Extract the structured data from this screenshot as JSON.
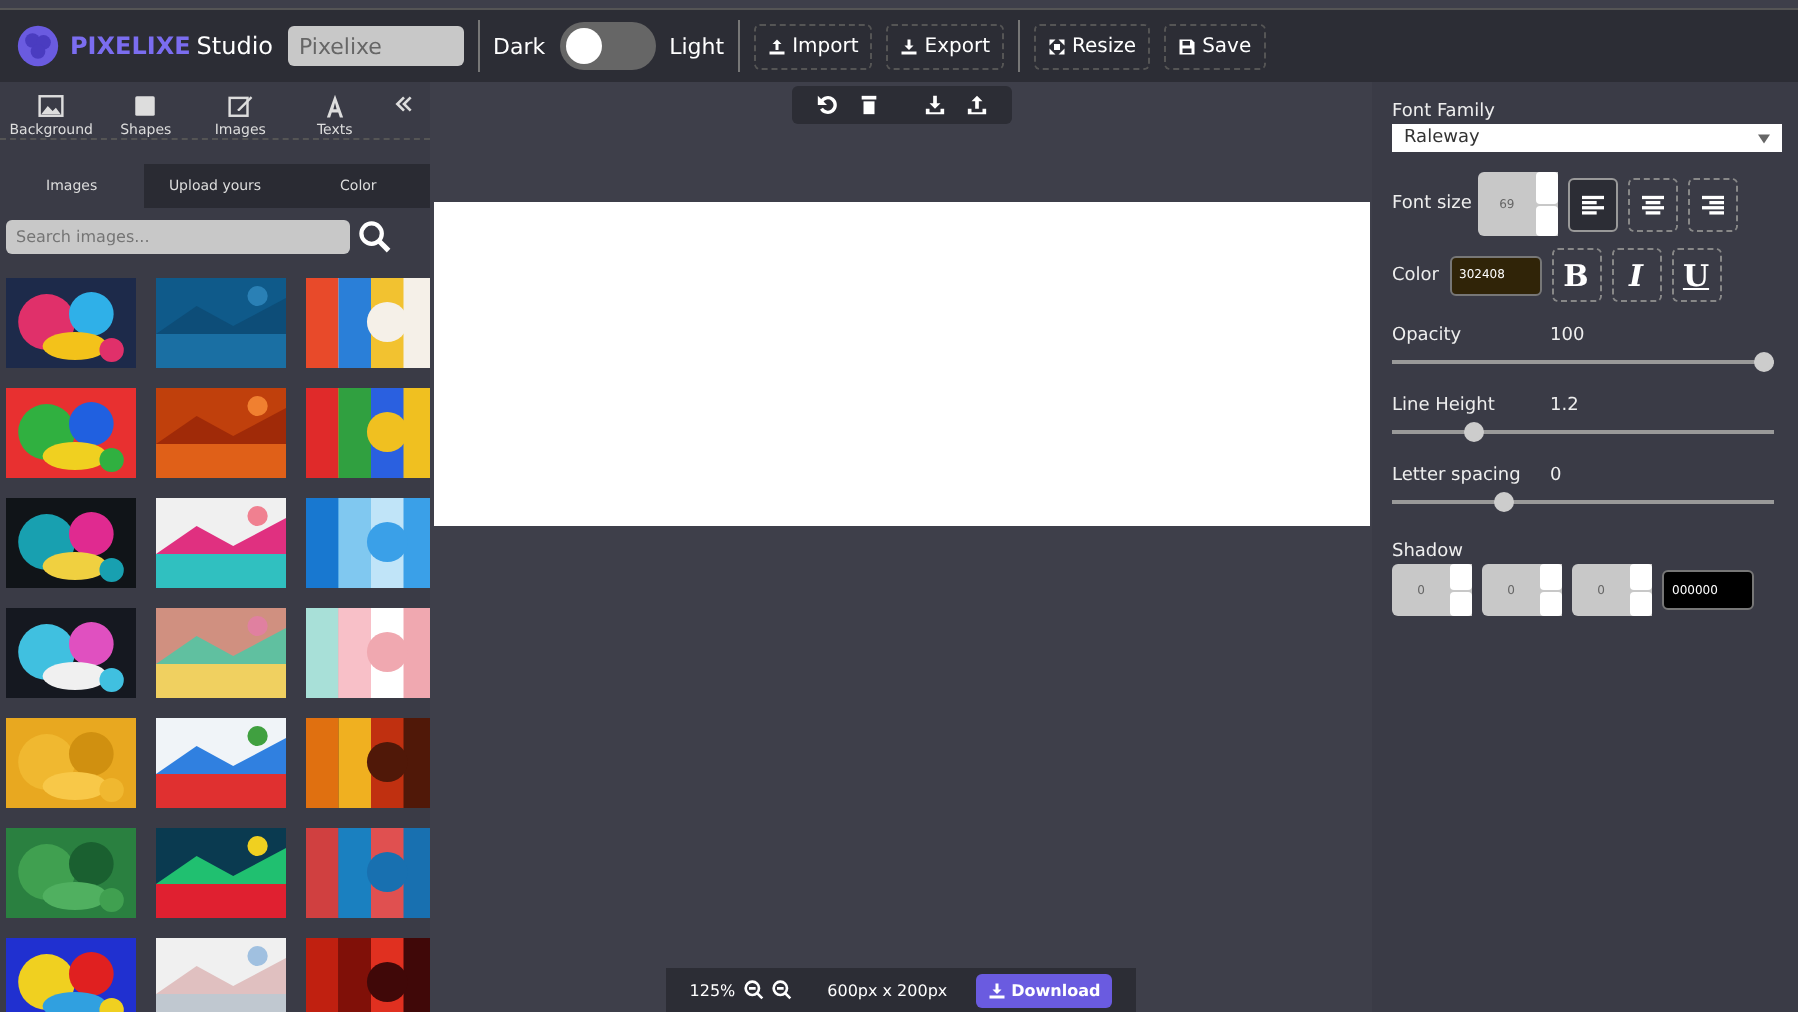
{
  "topbar": {
    "brand": "PIXELIXE",
    "product": "Studio",
    "project_name": "Pixelixe",
    "dark_label": "Dark",
    "light_label": "Light",
    "theme_toggle": {
      "on": false
    },
    "buttons": [
      {
        "kind": "import",
        "label": "Import"
      },
      {
        "kind": "export",
        "label": "Export"
      },
      {
        "kind": "resize",
        "label": "Resize"
      },
      {
        "kind": "save",
        "label": "Save"
      }
    ]
  },
  "tools": [
    {
      "kind": "background",
      "label": "Background"
    },
    {
      "kind": "shapes",
      "label": "Shapes"
    },
    {
      "kind": "images",
      "label": "Images"
    },
    {
      "kind": "texts",
      "label": "Texts"
    }
  ],
  "tabs": [
    {
      "label": "Images",
      "selected": true
    },
    {
      "label": "Upload yours",
      "selected": false
    },
    {
      "label": "Color",
      "selected": false
    }
  ],
  "search": {
    "placeholder": "Search images..."
  },
  "canvas_tools": [
    {
      "kind": "undo"
    },
    {
      "kind": "delete"
    },
    {
      "kind": "download"
    },
    {
      "kind": "upload"
    }
  ],
  "bottom_bar": {
    "zoom": "125%",
    "size": "600px x 200px",
    "download": "Download"
  },
  "properties": {
    "font_family_label": "Font Family",
    "font_family": "Raleway",
    "font_size_label": "Font size",
    "font_size": "69",
    "align": [
      {
        "kind": "left",
        "selected": true
      },
      {
        "kind": "center",
        "selected": false
      },
      {
        "kind": "right",
        "selected": false
      }
    ],
    "color_label": "Color",
    "color_value": "302408",
    "color": "#302408",
    "styles": [
      {
        "kind": "bold",
        "label": "B"
      },
      {
        "kind": "italic",
        "label": "I"
      },
      {
        "kind": "underline",
        "label": "U"
      }
    ],
    "sliders": [
      {
        "label": "Opacity",
        "reading": "100",
        "level": 1.0
      },
      {
        "label": "Line Height",
        "reading": "1.2",
        "level": 0.2
      },
      {
        "label": "Letter spacing",
        "reading": "0",
        "level": 0.28
      }
    ],
    "shadow_label": "Shadow",
    "shadow": [
      "0",
      "0",
      "0"
    ],
    "shadow_color": "000000"
  }
}
